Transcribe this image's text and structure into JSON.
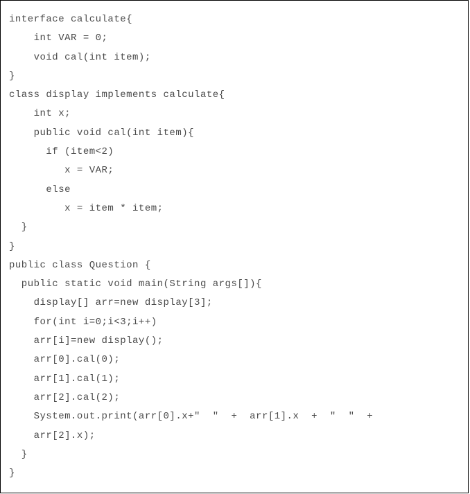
{
  "code": {
    "lines": [
      "interface calculate{",
      "    int VAR = 0;",
      "    void cal(int item);",
      "}",
      "class display implements calculate{",
      "    int x;",
      "    public void cal(int item){",
      "      if (item<2)",
      "         x = VAR;",
      "      else",
      "         x = item * item;",
      "  }",
      "}",
      "public class Question {",
      "  public static void main(String args[]){",
      "    display[] arr=new display[3];",
      "    for(int i=0;i<3;i++)",
      "    arr[i]=new display();",
      "    arr[0].cal(0);",
      "    arr[1].cal(1);",
      "    arr[2].cal(2);",
      "    System.out.print(arr[0].x+\"  \"  +  arr[1].x  +  \"  \"  +",
      "    arr[2].x);",
      "  }",
      "}"
    ]
  }
}
